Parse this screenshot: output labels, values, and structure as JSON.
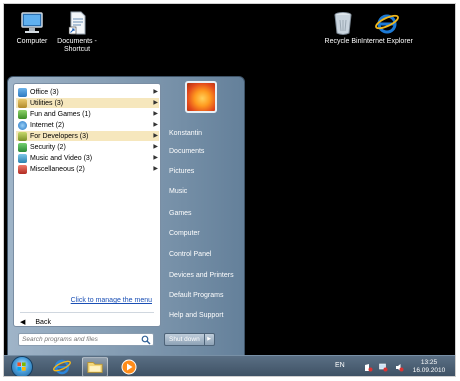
{
  "desktop": {
    "icons": [
      {
        "label": "Computer",
        "icon": "computer-icon"
      },
      {
        "label": "Documents - Shortcut",
        "icon": "documents-shortcut-icon"
      },
      {
        "label": "Recycle Bin",
        "icon": "recycle-bin-icon"
      },
      {
        "label": "Internet Explorer",
        "icon": "internet-explorer-icon"
      }
    ]
  },
  "start_menu": {
    "programs": [
      {
        "label": "Office (3)",
        "highlighted": false,
        "icon": "office-folder-icon"
      },
      {
        "label": "Utilities (3)",
        "highlighted": true,
        "icon": "utilities-folder-icon"
      },
      {
        "label": "Fun and Games (1)",
        "highlighted": false,
        "icon": "games-folder-icon"
      },
      {
        "label": "Internet (2)",
        "highlighted": false,
        "icon": "internet-folder-icon"
      },
      {
        "label": "For Developers (3)",
        "highlighted": true,
        "icon": "developers-folder-icon"
      },
      {
        "label": "Security (2)",
        "highlighted": false,
        "icon": "security-folder-icon"
      },
      {
        "label": "Music and Video (3)",
        "highlighted": false,
        "icon": "music-folder-icon"
      },
      {
        "label": "Miscellaneous (2)",
        "highlighted": false,
        "icon": "misc-folder-icon"
      }
    ],
    "manage_link": "Click to manage the menu",
    "back_label": "Back",
    "search_placeholder": "Search programs and files",
    "right_items": [
      {
        "label": "Konstantin"
      },
      {
        "label": "Documents"
      },
      {
        "label": "Pictures"
      },
      {
        "label": "Music"
      },
      {
        "label": "Games"
      },
      {
        "label": "Computer"
      },
      {
        "label": "Control Panel"
      },
      {
        "label": "Devices and Printers"
      },
      {
        "label": "Default Programs"
      },
      {
        "label": "Help and Support"
      }
    ],
    "shutdown_label": "Shut down"
  },
  "taskbar": {
    "language": "EN",
    "time": "13:25",
    "date": "16.09.2010",
    "pinned": [
      "internet-explorer-icon",
      "windows-explorer-icon",
      "media-player-icon"
    ]
  },
  "colors": {
    "highlight": "#f6e7bd",
    "link": "#1a4fb5"
  }
}
